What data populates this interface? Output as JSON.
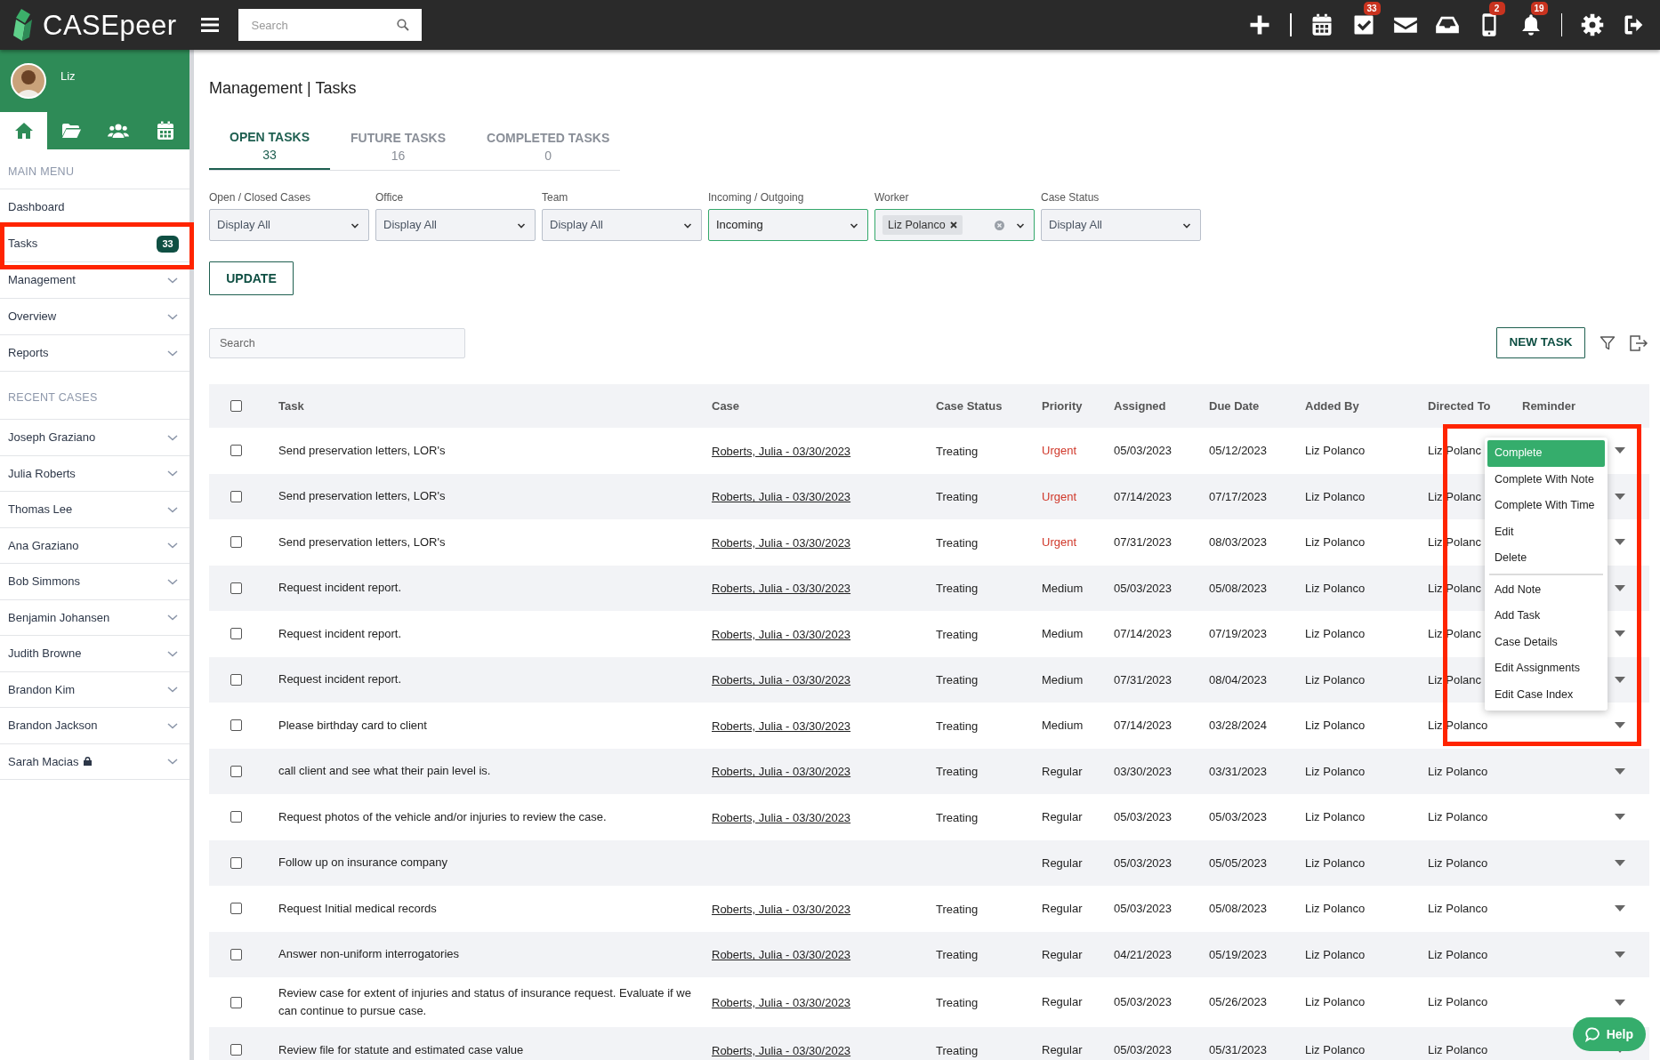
{
  "topbar": {
    "logo_text": "CASEpeer",
    "search": {
      "placeholder": "Search"
    },
    "icons": [
      {
        "kind": "plus"
      },
      {
        "kind": "divider"
      },
      {
        "kind": "calendar"
      },
      {
        "kind": "tasks",
        "badge": "33"
      },
      {
        "kind": "mail"
      },
      {
        "kind": "inbox"
      },
      {
        "kind": "phone",
        "badge": "2"
      },
      {
        "kind": "bell",
        "badge": "19"
      },
      {
        "kind": "divider"
      },
      {
        "kind": "settings"
      },
      {
        "kind": "logout"
      }
    ]
  },
  "sidebar": {
    "user_name": "Liz",
    "nav_tabs": [
      {
        "kind": "home",
        "selected": true
      },
      {
        "kind": "folder",
        "selected": false
      },
      {
        "kind": "users",
        "selected": false
      },
      {
        "kind": "calendar",
        "selected": false
      }
    ],
    "main_menu": {
      "heading": "MAIN MENU",
      "items": [
        {
          "label": "Dashboard",
          "has_submenu": false,
          "highlighted": false
        },
        {
          "label": "Tasks",
          "badge": "33",
          "has_submenu": false,
          "highlighted": true
        },
        {
          "label": "Management",
          "has_submenu": true,
          "highlighted": false
        },
        {
          "label": "Overview",
          "has_submenu": true,
          "highlighted": false
        },
        {
          "label": "Reports",
          "has_submenu": true,
          "highlighted": false
        }
      ]
    },
    "recent_cases": {
      "heading": "RECENT CASES",
      "items": [
        {
          "label": "Joseph Graziano",
          "locked": false
        },
        {
          "label": "Julia Roberts",
          "locked": false
        },
        {
          "label": "Thomas Lee",
          "locked": false
        },
        {
          "label": "Ana Graziano",
          "locked": false
        },
        {
          "label": "Bob Simmons",
          "locked": false
        },
        {
          "label": "Benjamin Johansen",
          "locked": false
        },
        {
          "label": "Judith Browne",
          "locked": false
        },
        {
          "label": "Brandon Kim",
          "locked": false
        },
        {
          "label": "Brandon Jackson",
          "locked": false
        },
        {
          "label": "Sarah Macias",
          "locked": true
        }
      ]
    }
  },
  "page_title": "Management | Tasks",
  "tabs": [
    {
      "label": "OPEN TASKS",
      "count": "33",
      "selected": true
    },
    {
      "label": "FUTURE TASKS",
      "count": "16",
      "selected": false
    },
    {
      "label": "COMPLETED TASKS",
      "count": "0",
      "selected": false
    }
  ],
  "filters": [
    {
      "label": "Open / Closed Cases",
      "value": "Display All",
      "active": false
    },
    {
      "label": "Office",
      "value": "Display All",
      "active": false
    },
    {
      "label": "Team",
      "value": "Display All",
      "active": false
    },
    {
      "label": "Incoming / Outgoing",
      "value": "Incoming",
      "active": true
    },
    {
      "label": "Worker",
      "tags": [
        "Liz Polanco"
      ],
      "active": true
    },
    {
      "label": "Case Status",
      "value": "Display All",
      "active": false
    }
  ],
  "update_button": "UPDATE",
  "table_search": {
    "placeholder": "Search"
  },
  "new_task_button": "NEW TASK",
  "table": {
    "select_all_checked": false,
    "columns": [
      "Task",
      "Case",
      "Case Status",
      "Priority",
      "Assigned",
      "Due Date",
      "Added By",
      "Directed To",
      "Reminder"
    ],
    "rows": [
      {
        "checked": false,
        "task": "Send preservation letters, LOR's",
        "case": "Roberts, Julia - 03/30/2023",
        "case_status": "Treating",
        "priority": "Urgent",
        "urgent": true,
        "assigned": "05/03/2023",
        "due_date": "05/12/2023",
        "added_by": "Liz Polanco",
        "directed_to": "Liz Polanc"
      },
      {
        "checked": false,
        "task": "Send preservation letters, LOR's",
        "case": "Roberts, Julia - 03/30/2023",
        "case_status": "Treating",
        "priority": "Urgent",
        "urgent": true,
        "assigned": "07/14/2023",
        "due_date": "07/17/2023",
        "added_by": "Liz Polanco",
        "directed_to": "Liz Polanc"
      },
      {
        "checked": false,
        "task": "Send preservation letters, LOR's",
        "case": "Roberts, Julia - 03/30/2023",
        "case_status": "Treating",
        "priority": "Urgent",
        "urgent": true,
        "assigned": "07/31/2023",
        "due_date": "08/03/2023",
        "added_by": "Liz Polanco",
        "directed_to": "Liz Polanc"
      },
      {
        "checked": false,
        "task": "Request incident report.",
        "case": "Roberts, Julia - 03/30/2023",
        "case_status": "Treating",
        "priority": "Medium",
        "urgent": false,
        "assigned": "05/03/2023",
        "due_date": "05/08/2023",
        "added_by": "Liz Polanco",
        "directed_to": "Liz Polanc"
      },
      {
        "checked": false,
        "task": "Request incident report.",
        "case": "Roberts, Julia - 03/30/2023",
        "case_status": "Treating",
        "priority": "Medium",
        "urgent": false,
        "assigned": "07/14/2023",
        "due_date": "07/19/2023",
        "added_by": "Liz Polanco",
        "directed_to": "Liz Polanc"
      },
      {
        "checked": false,
        "task": "Request incident report.",
        "case": "Roberts, Julia - 03/30/2023",
        "case_status": "Treating",
        "priority": "Medium",
        "urgent": false,
        "assigned": "07/31/2023",
        "due_date": "08/04/2023",
        "added_by": "Liz Polanco",
        "directed_to": "Liz Polanc"
      },
      {
        "checked": false,
        "task": "Please birthday card to client",
        "case": "Roberts, Julia - 03/30/2023",
        "case_status": "Treating",
        "priority": "Medium",
        "urgent": false,
        "assigned": "07/14/2023",
        "due_date": "03/28/2024",
        "added_by": "Liz Polanco",
        "directed_to": "Liz Polanco"
      },
      {
        "checked": false,
        "task": "call client and see what their pain level is.",
        "case": "Roberts, Julia - 03/30/2023",
        "case_status": "Treating",
        "priority": "Regular",
        "urgent": false,
        "assigned": "03/30/2023",
        "due_date": "03/31/2023",
        "added_by": "Liz Polanco",
        "directed_to": "Liz Polanco"
      },
      {
        "checked": false,
        "task": "Request photos of the vehicle and/or injuries to review the case.",
        "case": "Roberts, Julia - 03/30/2023",
        "case_status": "Treating",
        "priority": "Regular",
        "urgent": false,
        "assigned": "05/03/2023",
        "due_date": "05/03/2023",
        "added_by": "Liz Polanco",
        "directed_to": "Liz Polanco"
      },
      {
        "checked": false,
        "task": "Follow up on insurance company",
        "priority": "Regular",
        "urgent": false,
        "assigned": "05/03/2023",
        "due_date": "05/05/2023",
        "added_by": "Liz Polanco",
        "directed_to": "Liz Polanco"
      },
      {
        "checked": false,
        "task": "Request Initial medical records",
        "case": "Roberts, Julia - 03/30/2023",
        "case_status": "Treating",
        "priority": "Regular",
        "urgent": false,
        "assigned": "05/03/2023",
        "due_date": "05/08/2023",
        "added_by": "Liz Polanco",
        "directed_to": "Liz Polanco"
      },
      {
        "checked": false,
        "task": "Answer non-uniform interrogatories",
        "case": "Roberts, Julia - 03/30/2023",
        "case_status": "Treating",
        "priority": "Regular",
        "urgent": false,
        "assigned": "04/21/2023",
        "due_date": "05/19/2023",
        "added_by": "Liz Polanco",
        "directed_to": "Liz Polanco"
      },
      {
        "checked": false,
        "task": "Review case for extent of injuries and status of insurance request. Evaluate if we can continue to pursue case.",
        "case": "Roberts, Julia - 03/30/2023",
        "case_status": "Treating",
        "priority": "Regular",
        "urgent": false,
        "assigned": "05/03/2023",
        "due_date": "05/26/2023",
        "added_by": "Liz Polanco",
        "directed_to": "Liz Polanco"
      },
      {
        "checked": false,
        "task": "Review file for statute and estimated case value",
        "case": "Roberts, Julia - 03/30/2023",
        "case_status": "Treating",
        "priority": "Regular",
        "urgent": false,
        "assigned": "05/03/2023",
        "due_date": "05/31/2023",
        "added_by": "Liz Polanco",
        "directed_to": "Liz Polanco"
      }
    ]
  },
  "row_menu": {
    "highlighted": true,
    "groups": [
      {
        "items": [
          {
            "label": "Complete",
            "selected": true
          },
          {
            "label": "Complete With Note",
            "selected": false
          },
          {
            "label": "Complete With Time",
            "selected": false
          },
          {
            "label": "Edit",
            "selected": false
          },
          {
            "label": "Delete",
            "selected": false
          }
        ]
      },
      {
        "items": [
          {
            "label": "Add Note",
            "selected": false
          },
          {
            "label": "Add Task",
            "selected": false
          },
          {
            "label": "Case Details",
            "selected": false
          },
          {
            "label": "Edit Assignments",
            "selected": false
          },
          {
            "label": "Edit Case Index",
            "selected": false
          }
        ]
      }
    ]
  },
  "help_button": "Help"
}
